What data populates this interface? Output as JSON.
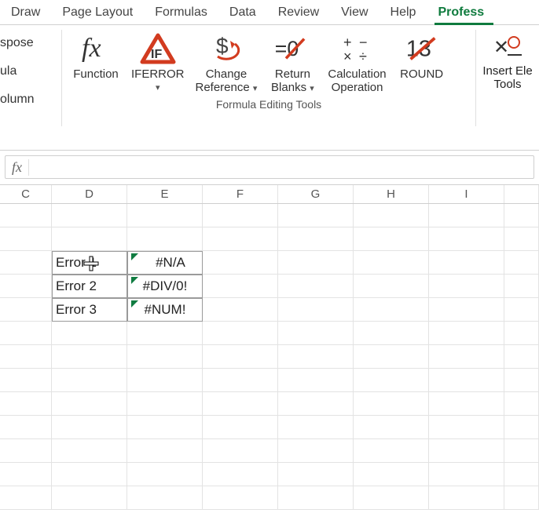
{
  "tabs": {
    "items": [
      "Draw",
      "Page Layout",
      "Formulas",
      "Data",
      "Review",
      "View",
      "Help",
      "Profess"
    ],
    "active_index": 7
  },
  "ribbon": {
    "left_items": [
      "spose",
      "ula",
      "olumn"
    ],
    "buttons": [
      {
        "label": "Function",
        "label2": "",
        "dropdown": false
      },
      {
        "label": "IFERROR",
        "label2": "",
        "dropdown": true
      },
      {
        "label": "Change",
        "label2": "Reference",
        "dropdown": true
      },
      {
        "label": "Return",
        "label2": "Blanks",
        "dropdown": true
      },
      {
        "label": "Calculation",
        "label2": "Operation",
        "dropdown": false
      },
      {
        "label": "ROUND",
        "label2": "",
        "dropdown": false
      }
    ],
    "group_title": "Formula Editing Tools",
    "right": {
      "line1": "Insert Ele",
      "line2": "Tools"
    }
  },
  "formula_bar": {
    "fx": "fx",
    "value": ""
  },
  "columns": [
    "C",
    "D",
    "E",
    "F",
    "G",
    "H",
    "I",
    ""
  ],
  "cells": {
    "D3": "Error 1",
    "E3": "#N/A",
    "D4": "Error 2",
    "E4": "#DIV/0!",
    "D5": "Error 3",
    "E5": "#NUM!"
  }
}
